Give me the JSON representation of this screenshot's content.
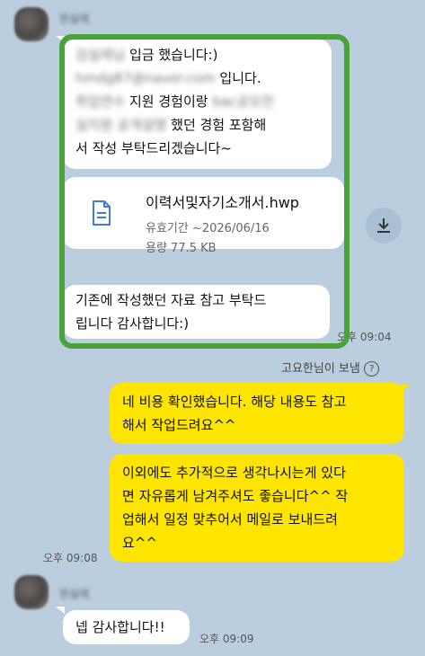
{
  "chat": {
    "sender_name": "한실레",
    "msg1": {
      "line1_blurred": "김실레님",
      "line1_text": " 입금 했습니다:)",
      "line2_blurred": "hmdg87@naver.com",
      "line2_text": " 입니다.",
      "line3_blurred": "취업연수",
      "line3_text": " 지원 경험이랑 ",
      "line3_blurred2": "bac공모전",
      "line4_blurred": "실지원 공개설명",
      "line4_text": " 했던 경험 포함해",
      "line5_text": "서 작성 부탁드리겠습니다~"
    },
    "file": {
      "name": "이력서및자기소개서.hwp",
      "validity": "유효기간 ~2026/06/16",
      "size": "용량 77.5 KB",
      "icon": "document-icon",
      "download_icon": "download-icon"
    },
    "msg3": {
      "line1": "기존에 작성했던 자료 참고 부탁드",
      "line2": "립니다 감사합니다:)"
    },
    "time1": "오후 09:04",
    "sent_by": "고요한님이 보냄",
    "reply1": {
      "line1": "네 비용 확인했습니다. 해당 내용도 참고",
      "line2": "해서 작업드려요^^"
    },
    "reply2": {
      "line1": "이외에도 추가적으로 생각나시는게 있다",
      "line2": "면 자유롭게 남겨주셔도 좋습니다^^ 작",
      "line3": "업해서 일정 맞추어서 메일로 보내드려",
      "line4": "요^^"
    },
    "time2": "오후 09:08",
    "msg4": "넵 감사합니다!!",
    "time3": "오후 09:09"
  },
  "colors": {
    "background": "#bacee0",
    "incoming_bubble": "#ffffff",
    "outgoing_bubble": "#fee500",
    "highlight_border": "#4aa339",
    "file_icon": "#3b7dd8"
  }
}
